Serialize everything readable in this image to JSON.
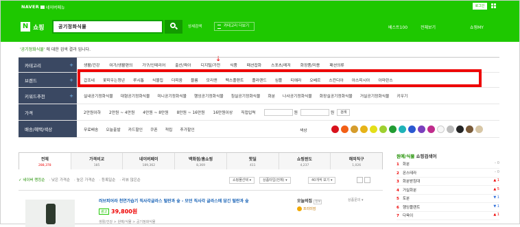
{
  "header": {
    "naver": "NAVER",
    "menu": "네이버메뉴",
    "login": "로그인",
    "brand": "쇼핑",
    "query": "공기정화식물",
    "advanced": "상세검색",
    "category_view": "카테고리 더보기",
    "links": [
      "베스트100",
      "전체보기",
      "쇼핑MY"
    ]
  },
  "desc": {
    "keyword": "'공기정화식물'",
    "rest": " 에 대한 검색 결과 입니다."
  },
  "panel": {
    "category": {
      "label": "카테고리",
      "items": [
        "생활/건강",
        "여가/생활편의",
        "가구/인테리어",
        "출산/육아",
        "디지털/가전",
        "식품",
        "패션잡화",
        "스포츠/레저",
        "화장품/미용",
        "패션의류"
      ]
    },
    "brand": {
      "label": "브랜드",
      "items": [
        "갑조네",
        "꽃피우는청년",
        "루시톱",
        "식물집",
        "더피움",
        "블룸",
        "모리앤",
        "펙스플랜트",
        "플라랜드",
        "심플",
        "티에라",
        "오베르",
        "스칸디아",
        "아스피시아",
        "아마란스"
      ]
    },
    "keyword": {
      "label": "키워드추천",
      "items": [
        "실내공기정화식물",
        "대형공기정화식물",
        "미니공기정화식물",
        "행잉공기정화식물",
        "침실공기정화식물",
        "화분",
        "나사공기정화식물",
        "화장실공기정화식물",
        "거실공기정화식물",
        "키우기"
      ]
    },
    "price": {
      "label": "가격",
      "items": [
        "2만원이하",
        "2만원 ~ 4만원",
        "4만원 ~ 8만원",
        "8만원 ~ 16만원",
        "16만원이상",
        "직접입력"
      ],
      "won": "원",
      "confirm": "검색"
    },
    "delivery": {
      "label": "배송/혜택/색상",
      "items": [
        "무료배송",
        "오늘출발",
        "카드할인",
        "쿠폰",
        "적립",
        "추가할인"
      ],
      "color_label": "색상"
    },
    "colors": [
      "#d8111c",
      "#f25f16",
      "#d59c2c",
      "#e6b318",
      "#e4df19",
      "#9ed030",
      "#219c33",
      "#1fb3b8",
      "#2a58d1",
      "#7a3fbd",
      "#c02c8c",
      "#f7f7f7",
      "#bcbcbc",
      "#242424",
      "#7a5b3a",
      "#d8c7a6"
    ]
  },
  "tabs": [
    {
      "t": "전체",
      "c": "288,378"
    },
    {
      "t": "가격비교",
      "c": "185"
    },
    {
      "t": "네이버페이",
      "c": "189,362"
    },
    {
      "t": "백화점/홈쇼핑",
      "c": "8,369"
    },
    {
      "t": "핫딜",
      "c": "411"
    },
    {
      "t": "쇼핑윈도",
      "c": "4,237"
    },
    {
      "t": "해외직구",
      "c": "1,026"
    }
  ],
  "filter": {
    "items": [
      "✓ 네이버 랭킹순",
      "· 낮은 가격순",
      "· 높은 가격순",
      "· 등록일순",
      "· 리뷰 많은순"
    ],
    "selects": [
      "쇼핑몰선택 ▾",
      "상품타입(전체) ▾",
      "40개씩 보기 ▾"
    ]
  },
  "item": {
    "title": "러브피어라 천연가습기 직사각글라스 털란과 숲 - 모던 직사각 글라스에 담긴 털란과 숲",
    "price": "39,800원",
    "ad": "광고",
    "cat": "생활/건강 > 원예/식물 > 공기정화식물",
    "mall": "오늘의집",
    "mall_tag": "정보",
    "badge": "프리미엄",
    "detail": "상품문의 ▾"
  },
  "side": {
    "title_green": "원예/식물",
    "title_rest": " 쇼핑검색어",
    "ranks": [
      {
        "n": "1",
        "t": "화분",
        "c": "–  0",
        "d": "eq"
      },
      {
        "n": "2",
        "t": "몬스테라",
        "c": "–  0",
        "d": "eq"
      },
      {
        "n": "3",
        "t": "화분받침대",
        "c": "▲ 1",
        "d": "up"
      },
      {
        "n": "4",
        "t": "거실화분",
        "c": "▲ 5",
        "d": "up"
      },
      {
        "n": "5",
        "t": "토분",
        "c": "▼ 1",
        "d": "dn"
      },
      {
        "n": "6",
        "t": "행잉플랜트",
        "c": "▼ 1",
        "d": "dn"
      },
      {
        "n": "7",
        "t": "다육이",
        "c": "▲ 1",
        "d": "up"
      }
    ]
  }
}
